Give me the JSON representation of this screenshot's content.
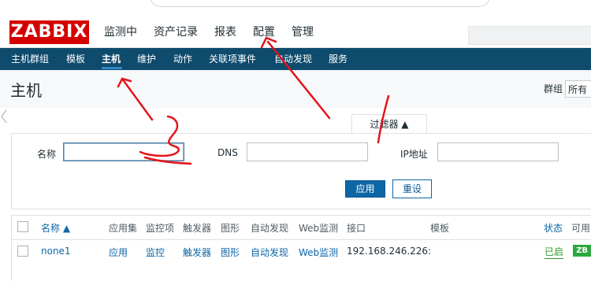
{
  "logo": "ZABBIX",
  "main_nav": [
    "监测中",
    "资产记录",
    "报表",
    "配置",
    "管理"
  ],
  "sub_nav": [
    "主机群组",
    "模板",
    "主机",
    "维护",
    "动作",
    "关联项事件",
    "自动发现",
    "服务"
  ],
  "page_title": "主机",
  "group_filter": {
    "label": "群组",
    "value": "所有"
  },
  "filter": {
    "tab_label": "过滤器 ▲",
    "name_label": "名称",
    "dns_label": "DNS",
    "ip_label": "IP地址",
    "name_value": "",
    "dns_value": "",
    "ip_value": "",
    "apply_label": "应用",
    "reset_label": "重设"
  },
  "table": {
    "headers": {
      "name": "名称 ▲",
      "applications": "应用集",
      "items": "监控项",
      "triggers": "触发器",
      "graphs": "图形",
      "discovery": "自动发现",
      "web": "Web监测",
      "interface": "接口",
      "templates": "模板",
      "status": "状态",
      "availability": "可用"
    },
    "rows": [
      {
        "name": "none1",
        "applications": "应用",
        "items": "监控",
        "triggers": "触发器",
        "graphs": "图形",
        "discovery": "自动发现",
        "web": "Web监测",
        "interface": "192.168.246.226:",
        "status": "已启",
        "availability": "ZB"
      }
    ]
  },
  "colors": {
    "brand": "#d40000",
    "subnav_bg": "#0e4b6c",
    "link": "#0d66a6",
    "annotation": "#e3141b"
  }
}
